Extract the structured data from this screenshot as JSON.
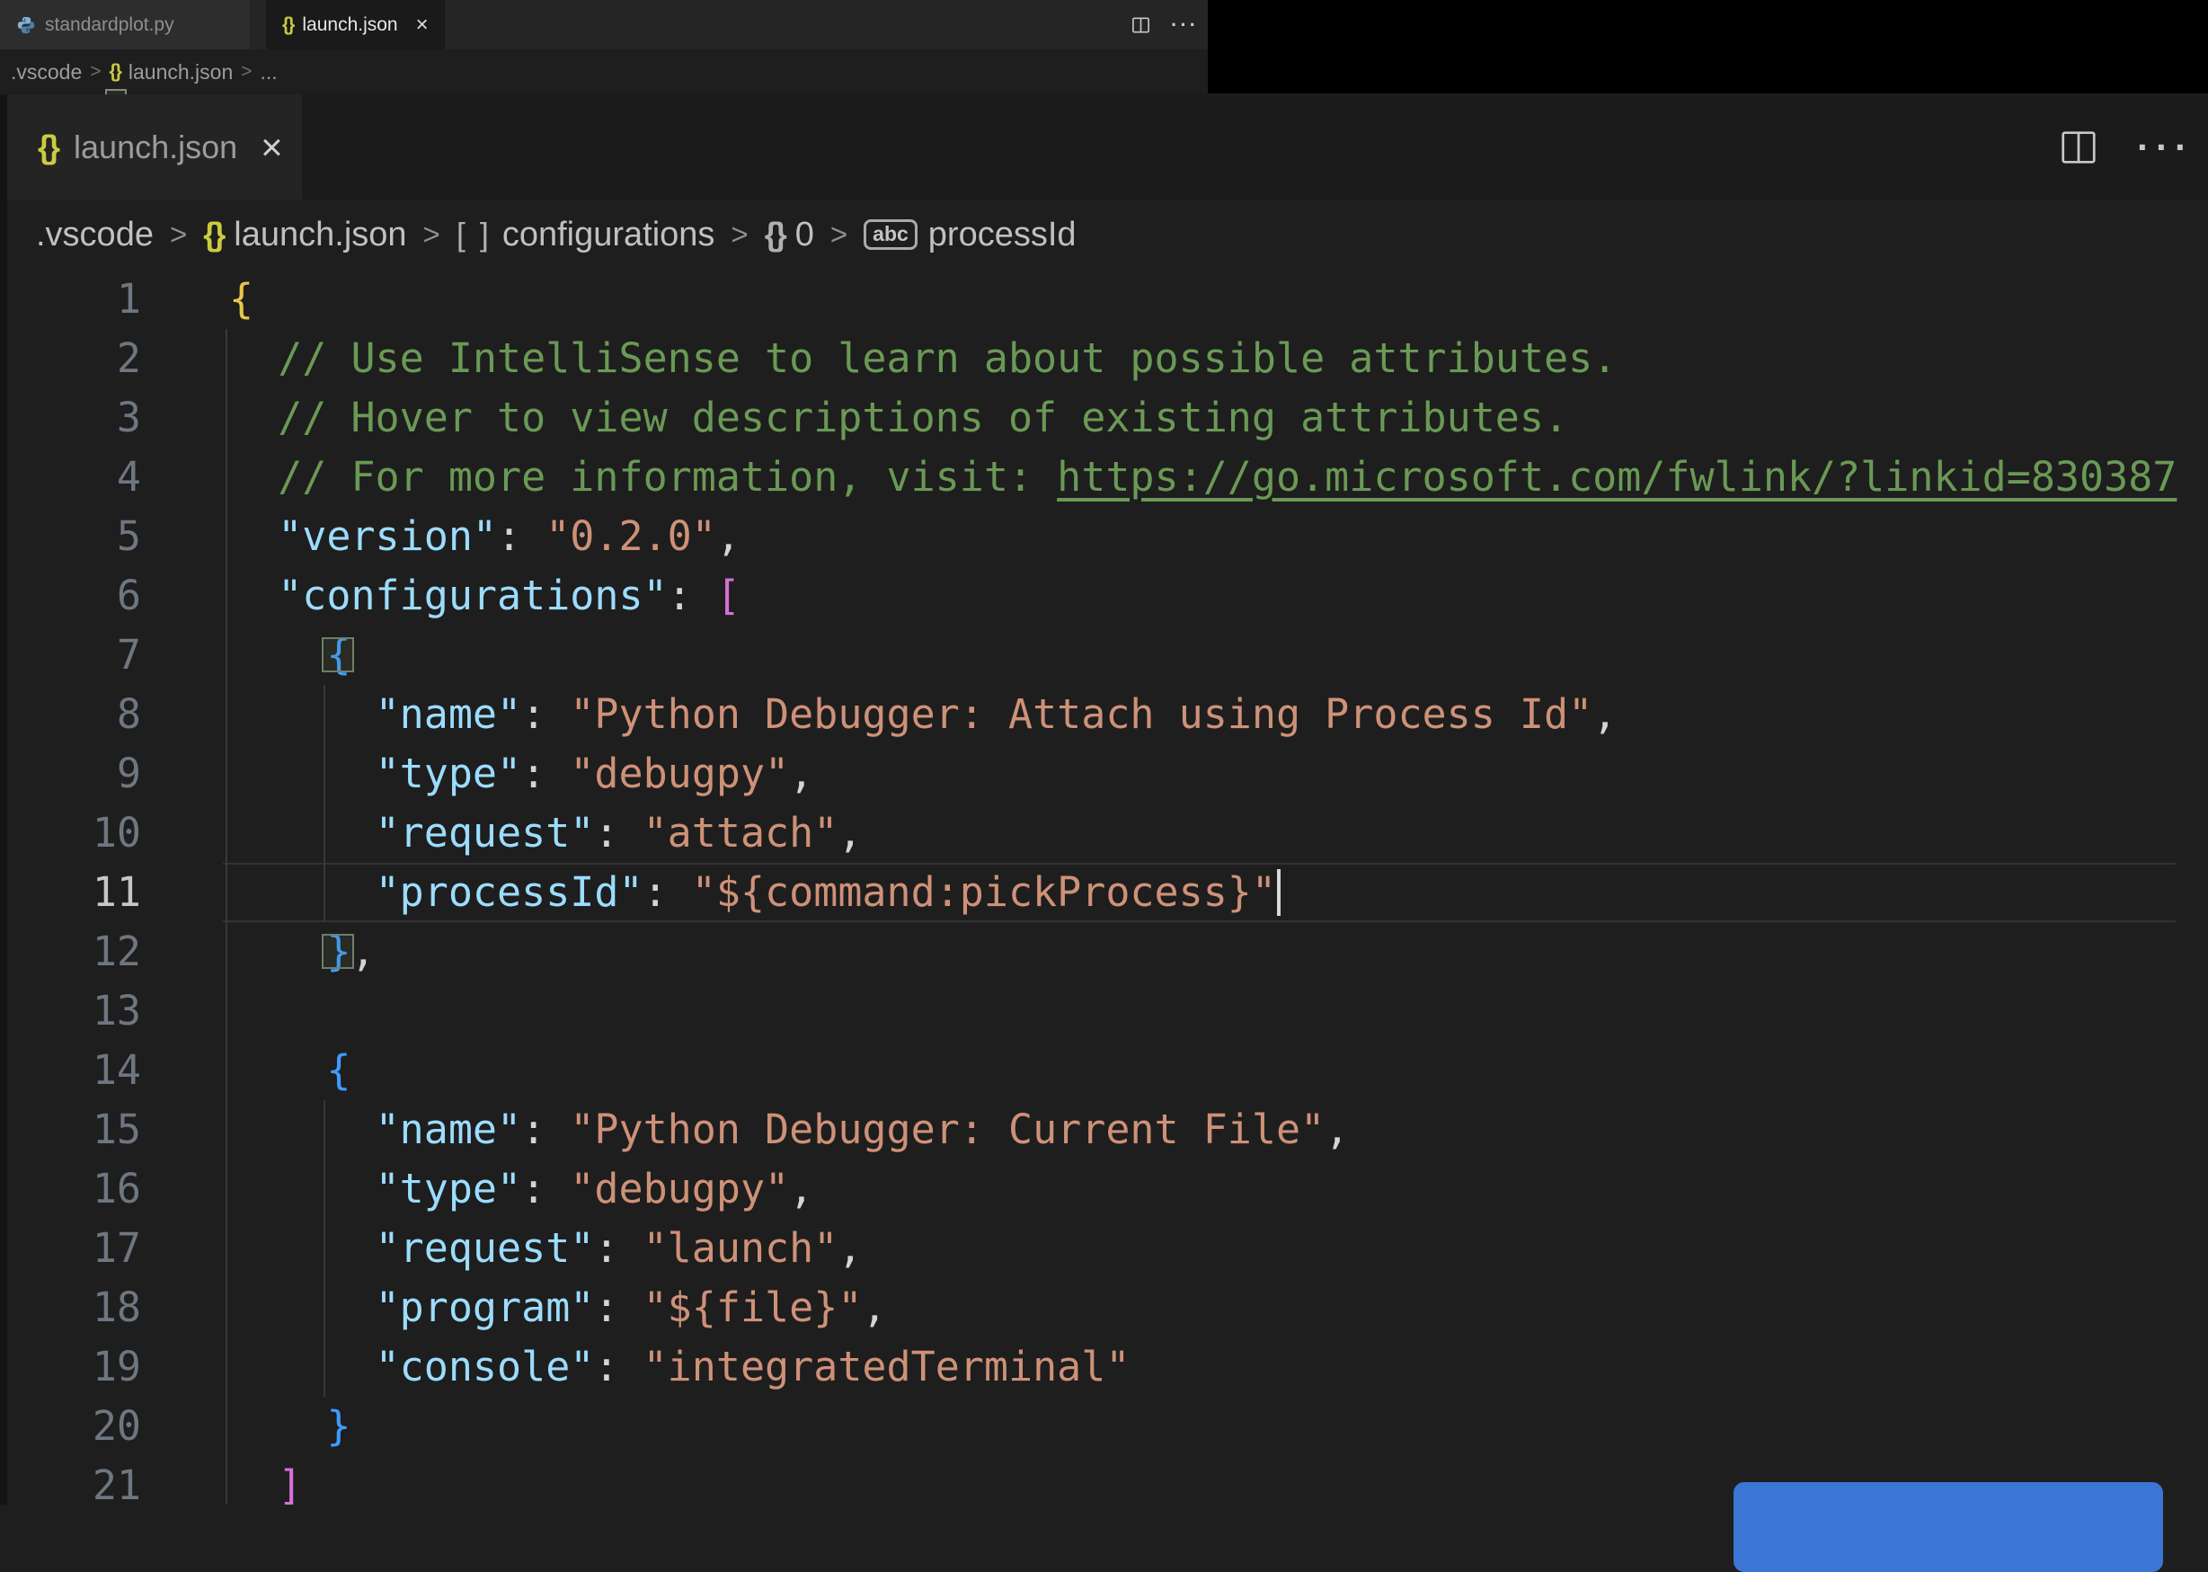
{
  "colors": {
    "editor_background": "#1e1e1e",
    "tabbar_background": "#252526",
    "black_patch": "#000000",
    "comment": "#6a9955",
    "property_key": "#9cdcfe",
    "string_value": "#ce9178",
    "bracket_gold": "#e9c64b",
    "bracket_pink": "#d670d6",
    "bracket_blue": "#3e9cff",
    "button_blue": "#3b76d4",
    "json_icon_yellow": "#cbcb41"
  },
  "glyphs": {
    "chevron": ">",
    "close": "×",
    "dots": "···",
    "braces": "{}",
    "brackets": "[ ]",
    "more": "..."
  },
  "top_bar": {
    "tabs": [
      {
        "label": "standardplot.py"
      },
      {
        "label": "launch.json"
      }
    ]
  },
  "top_breadcrumb": {
    "folder": ".vscode",
    "file": "launch.json",
    "more": "..."
  },
  "zoom_panel": {
    "tab": {
      "label": "launch.json"
    },
    "breadcrumb": {
      "items": [
        {
          "label": ".vscode"
        },
        {
          "label": "launch.json"
        },
        {
          "label": "configurations"
        },
        {
          "label": "0"
        },
        {
          "label": "processId"
        }
      ],
      "abc_icon_text": "abc"
    },
    "editor": {
      "cursor_line": 11,
      "lines": [
        {
          "n": 1,
          "segs": [
            {
              "t": "{",
              "c": "b1"
            }
          ]
        },
        {
          "n": 2,
          "segs": [
            {
              "t": "  ",
              "c": "p"
            },
            {
              "t": "// Use IntelliSense to learn about possible attributes.",
              "c": "c"
            }
          ]
        },
        {
          "n": 3,
          "segs": [
            {
              "t": "  ",
              "c": "p"
            },
            {
              "t": "// Hover to view descriptions of existing attributes.",
              "c": "c"
            }
          ]
        },
        {
          "n": 4,
          "segs": [
            {
              "t": "  ",
              "c": "p"
            },
            {
              "t": "// For more information, visit: ",
              "c": "c"
            },
            {
              "t": "https://go.microsoft.com/fwlink/?linkid=830387",
              "c": "c",
              "u": true
            }
          ]
        },
        {
          "n": 5,
          "segs": [
            {
              "t": "  ",
              "c": "p"
            },
            {
              "t": "\"version\"",
              "c": "k"
            },
            {
              "t": ": ",
              "c": "p"
            },
            {
              "t": "\"0.2.0\"",
              "c": "s"
            },
            {
              "t": ",",
              "c": "p"
            }
          ]
        },
        {
          "n": 6,
          "segs": [
            {
              "t": "  ",
              "c": "p"
            },
            {
              "t": "\"configurations\"",
              "c": "k"
            },
            {
              "t": ": ",
              "c": "p"
            },
            {
              "t": "[",
              "c": "b2"
            }
          ]
        },
        {
          "n": 7,
          "segs": [
            {
              "t": "    ",
              "c": "p"
            },
            {
              "t": "{",
              "c": "b3",
              "box": true
            }
          ]
        },
        {
          "n": 8,
          "segs": [
            {
              "t": "      ",
              "c": "p"
            },
            {
              "t": "\"name\"",
              "c": "k"
            },
            {
              "t": ": ",
              "c": "p"
            },
            {
              "t": "\"Python Debugger: Attach using Process Id\"",
              "c": "s"
            },
            {
              "t": ",",
              "c": "p"
            }
          ]
        },
        {
          "n": 9,
          "segs": [
            {
              "t": "      ",
              "c": "p"
            },
            {
              "t": "\"type\"",
              "c": "k"
            },
            {
              "t": ": ",
              "c": "p"
            },
            {
              "t": "\"debugpy\"",
              "c": "s"
            },
            {
              "t": ",",
              "c": "p"
            }
          ]
        },
        {
          "n": 10,
          "segs": [
            {
              "t": "      ",
              "c": "p"
            },
            {
              "t": "\"request\"",
              "c": "k"
            },
            {
              "t": ": ",
              "c": "p"
            },
            {
              "t": "\"attach\"",
              "c": "s"
            },
            {
              "t": ",",
              "c": "p"
            }
          ]
        },
        {
          "n": 11,
          "current": true,
          "cursor": true,
          "segs": [
            {
              "t": "      ",
              "c": "p"
            },
            {
              "t": "\"processId\"",
              "c": "k"
            },
            {
              "t": ": ",
              "c": "p"
            },
            {
              "t": "\"${command:pickProcess}\"",
              "c": "s"
            }
          ]
        },
        {
          "n": 12,
          "segs": [
            {
              "t": "    ",
              "c": "p"
            },
            {
              "t": "}",
              "c": "b3",
              "box": true
            },
            {
              "t": ",",
              "c": "p"
            }
          ]
        },
        {
          "n": 13,
          "segs": []
        },
        {
          "n": 14,
          "segs": [
            {
              "t": "    ",
              "c": "p"
            },
            {
              "t": "{",
              "c": "b3"
            }
          ]
        },
        {
          "n": 15,
          "segs": [
            {
              "t": "      ",
              "c": "p"
            },
            {
              "t": "\"name\"",
              "c": "k"
            },
            {
              "t": ": ",
              "c": "p"
            },
            {
              "t": "\"Python Debugger: Current File\"",
              "c": "s"
            },
            {
              "t": ",",
              "c": "p"
            }
          ]
        },
        {
          "n": 16,
          "segs": [
            {
              "t": "      ",
              "c": "p"
            },
            {
              "t": "\"type\"",
              "c": "k"
            },
            {
              "t": ": ",
              "c": "p"
            },
            {
              "t": "\"debugpy\"",
              "c": "s"
            },
            {
              "t": ",",
              "c": "p"
            }
          ]
        },
        {
          "n": 17,
          "segs": [
            {
              "t": "      ",
              "c": "p"
            },
            {
              "t": "\"request\"",
              "c": "k"
            },
            {
              "t": ": ",
              "c": "p"
            },
            {
              "t": "\"launch\"",
              "c": "s"
            },
            {
              "t": ",",
              "c": "p"
            }
          ]
        },
        {
          "n": 18,
          "segs": [
            {
              "t": "      ",
              "c": "p"
            },
            {
              "t": "\"program\"",
              "c": "k"
            },
            {
              "t": ": ",
              "c": "p"
            },
            {
              "t": "\"${file}\"",
              "c": "s"
            },
            {
              "t": ",",
              "c": "p"
            }
          ]
        },
        {
          "n": 19,
          "segs": [
            {
              "t": "      ",
              "c": "p"
            },
            {
              "t": "\"console\"",
              "c": "k"
            },
            {
              "t": ": ",
              "c": "p"
            },
            {
              "t": "\"integratedTerminal\"",
              "c": "s"
            }
          ]
        },
        {
          "n": 20,
          "segs": [
            {
              "t": "    ",
              "c": "p"
            },
            {
              "t": "}",
              "c": "b3"
            }
          ]
        },
        {
          "n": 21,
          "segs": [
            {
              "t": "  ",
              "c": "p"
            },
            {
              "t": "]",
              "c": "b2"
            }
          ]
        }
      ]
    }
  }
}
